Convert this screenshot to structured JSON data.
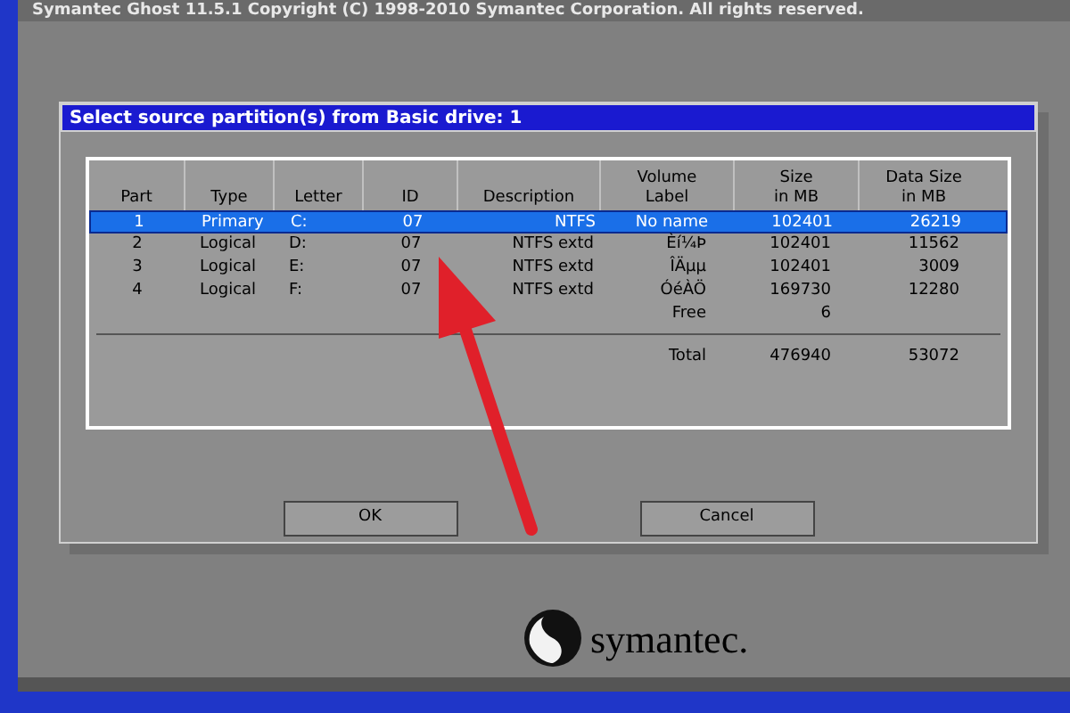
{
  "banner": {
    "text": "Symantec Ghost 11.5.1   Copyright (C) 1998-2010 Symantec Corporation. All rights reserved."
  },
  "dialog": {
    "title": "Select source partition(s) from Basic drive: 1",
    "table": {
      "columns": [
        "Part",
        "Type",
        "Letter",
        "ID",
        "Description",
        "Volume\nLabel",
        "Size\nin MB",
        "Data Size\nin MB"
      ],
      "rows": [
        {
          "selected": true,
          "cells": [
            "1",
            "Primary",
            "C:",
            "07",
            "NTFS",
            "No name",
            "102401",
            "26219"
          ]
        },
        {
          "selected": false,
          "cells": [
            "2",
            "Logical",
            "D:",
            "07",
            "NTFS extd",
            "Èí¼Þ",
            "102401",
            "11562"
          ]
        },
        {
          "selected": false,
          "cells": [
            "3",
            "Logical",
            "E:",
            "07",
            "NTFS extd",
            "ÎÄµµ",
            "102401",
            "3009"
          ]
        },
        {
          "selected": false,
          "cells": [
            "4",
            "Logical",
            "F:",
            "07",
            "NTFS extd",
            "ÓéÀÖ",
            "169730",
            "12280"
          ]
        }
      ],
      "free": {
        "label": "Free",
        "size": "6"
      },
      "total": {
        "label": "Total",
        "size": "476940",
        "data_size": "53072"
      }
    },
    "buttons": [
      "OK",
      "Cancel"
    ]
  },
  "logo": {
    "text": "symantec."
  }
}
